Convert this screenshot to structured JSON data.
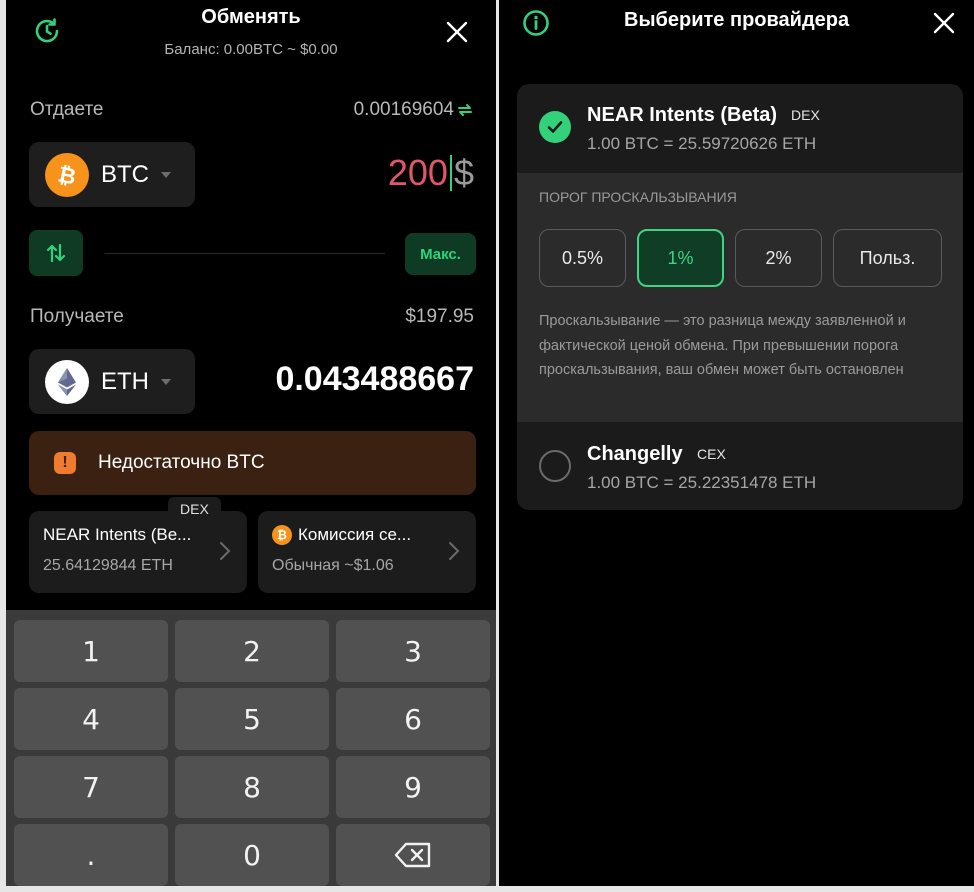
{
  "swap": {
    "title": "Обменять",
    "balance": "Баланс: 0.00BTC ~ $0.00",
    "give_label": "Отдаете",
    "give_crypto_amount": "0.00169604",
    "from_token": {
      "symbol": "BTC",
      "color": "#f7931a",
      "icon": "bitcoin-icon"
    },
    "amount_input": "200",
    "amount_currency": "$",
    "max_label": "Макс.",
    "receive_label": "Получаете",
    "receive_usd": "$197.95",
    "to_token": {
      "symbol": "ETH",
      "color": "#ffffff",
      "icon": "ethereum-icon"
    },
    "receive_amount": "0.043488667",
    "warning": "Недостаточно BTC",
    "provider_card": {
      "tag": "DEX",
      "title": "NEAR Intents (Be...",
      "subtitle": "25.64129844 ETH"
    },
    "fee_card": {
      "title": "Комиссия се...",
      "subtitle": "Обычная ~$1.06"
    },
    "keypad": [
      "1",
      "2",
      "3",
      "4",
      "5",
      "6",
      "7",
      "8",
      "9",
      ".",
      "0"
    ]
  },
  "provider_select": {
    "title": "Выберите провайдера",
    "providers": [
      {
        "name": "NEAR Intents (Beta)",
        "tag": "DEX",
        "rate": "1.00 BTC = 25.59720626 ETH",
        "selected": true
      },
      {
        "name": "Changelly",
        "tag": "CEX",
        "rate": "1.00 BTC = 25.22351478 ETH",
        "selected": false
      }
    ],
    "slippage": {
      "heading": "ПОРОГ ПРОСКАЛЬЗЫВАНИЯ",
      "options": [
        "0.5%",
        "1%",
        "2%",
        "Польз."
      ],
      "active": "1%",
      "description": "Проскальзывание — это разница между заявленной и фактической ценой обмена. При превышении порога проскальзывания, ваш обмен может быть остановлен"
    }
  },
  "colors": {
    "accent_green": "#33d17a",
    "amount_red": "#e0566b",
    "warning_bg": "#3b2111",
    "warning_icon": "#ef7b2e"
  }
}
